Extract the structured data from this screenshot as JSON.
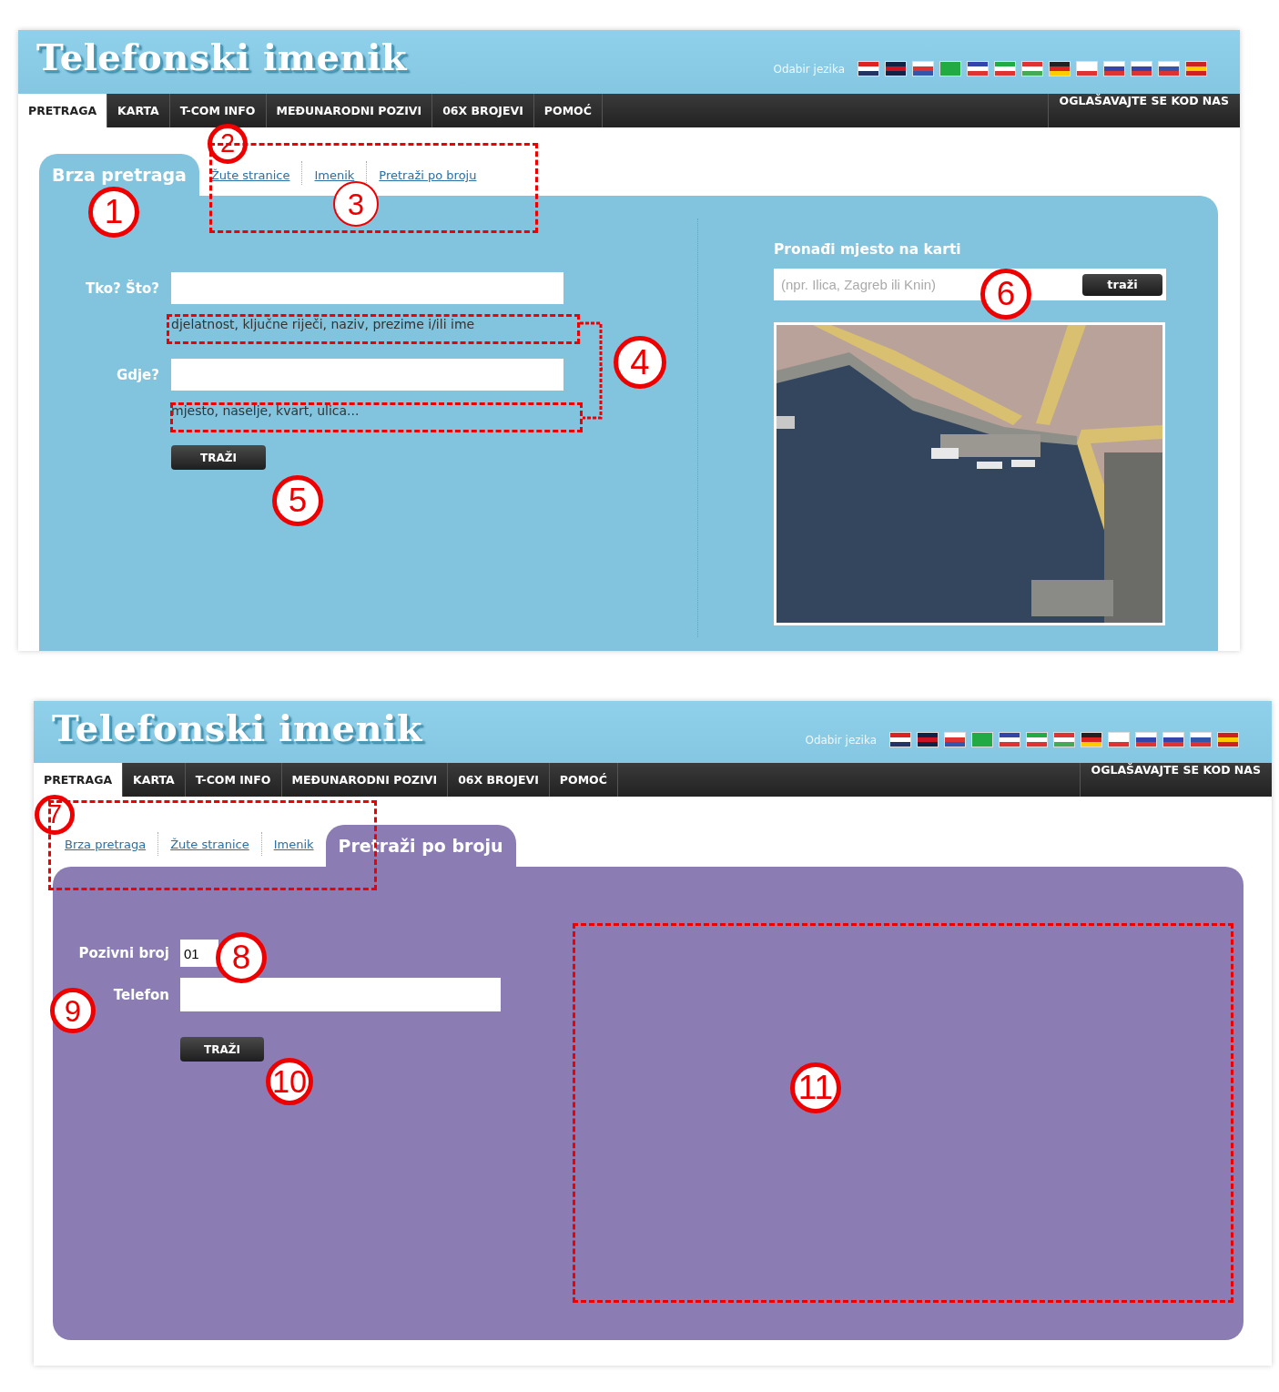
{
  "screens": [
    {
      "kind": "quick_search",
      "header": {
        "title": "Telefonski imenik",
        "language_label": "Odabir jezika"
      },
      "nav": [
        {
          "label": "PRETRAGA",
          "selected": true
        },
        {
          "label": "KARTA",
          "selected": false
        },
        {
          "label": "T-COM INFO",
          "selected": false
        },
        {
          "label": "MEĐUNARODNI POZIVI",
          "selected": false
        },
        {
          "label": "06X BROJEVI",
          "selected": false
        },
        {
          "label": "POMOĆ",
          "selected": false
        }
      ],
      "nav_right": "OGLAŠAVAJTE SE KOD NAS",
      "tabs": [
        {
          "label": "Brza pretraga",
          "selected": true
        },
        {
          "label": "Žute stranice",
          "selected": false
        },
        {
          "label": "Imenik",
          "selected": false
        },
        {
          "label": "Pretraži po broju",
          "selected": false
        }
      ],
      "form": {
        "fields": [
          {
            "kind": "wide",
            "label": "Tko? Što?",
            "hint": "djelatnost, ključne riječi, naziv, prezime i/ili ime"
          },
          {
            "kind": "wide",
            "label": "Gdje?",
            "hint": "mjesto, naselje, kvart, ulica..."
          }
        ],
        "button": "TRAŽI"
      },
      "map": {
        "title": "Pronađi mjesto na karti",
        "search": {
          "placeholder": "(npr. Ilica, Zagreb ili Knin)"
        },
        "button": "traži"
      }
    },
    {
      "kind": "number_search",
      "header": {
        "title": "Telefonski imenik",
        "language_label": "Odabir jezika"
      },
      "nav": [
        {
          "label": "PRETRAGA",
          "selected": true
        },
        {
          "label": "KARTA",
          "selected": false
        },
        {
          "label": "T-COM INFO",
          "selected": false
        },
        {
          "label": "MEĐUNARODNI POZIVI",
          "selected": false
        },
        {
          "label": "06X BROJEVI",
          "selected": false
        },
        {
          "label": "POMOĆ",
          "selected": false
        }
      ],
      "nav_right": "OGLAŠAVAJTE SE KOD NAS",
      "tabs": [
        {
          "label": "Brza pretraga",
          "selected": false
        },
        {
          "label": "Žute stranice",
          "selected": false
        },
        {
          "label": "Imenik",
          "selected": false
        },
        {
          "label": "Pretraži po broju",
          "selected": true
        }
      ],
      "form": {
        "fields": [
          {
            "kind": "short",
            "label": "Pozivni broj",
            "value": "01"
          },
          {
            "kind": "wide",
            "label": "Telefon"
          }
        ],
        "button": "TRAŽI"
      }
    }
  ],
  "annotations": [
    {
      "number": "1"
    },
    {
      "number": "2"
    },
    {
      "number": "3"
    },
    {
      "number": "4"
    },
    {
      "number": "5"
    },
    {
      "number": "6"
    },
    {
      "number": "7"
    },
    {
      "number": "8"
    },
    {
      "number": "9"
    },
    {
      "number": "10"
    },
    {
      "number": "11"
    }
  ]
}
